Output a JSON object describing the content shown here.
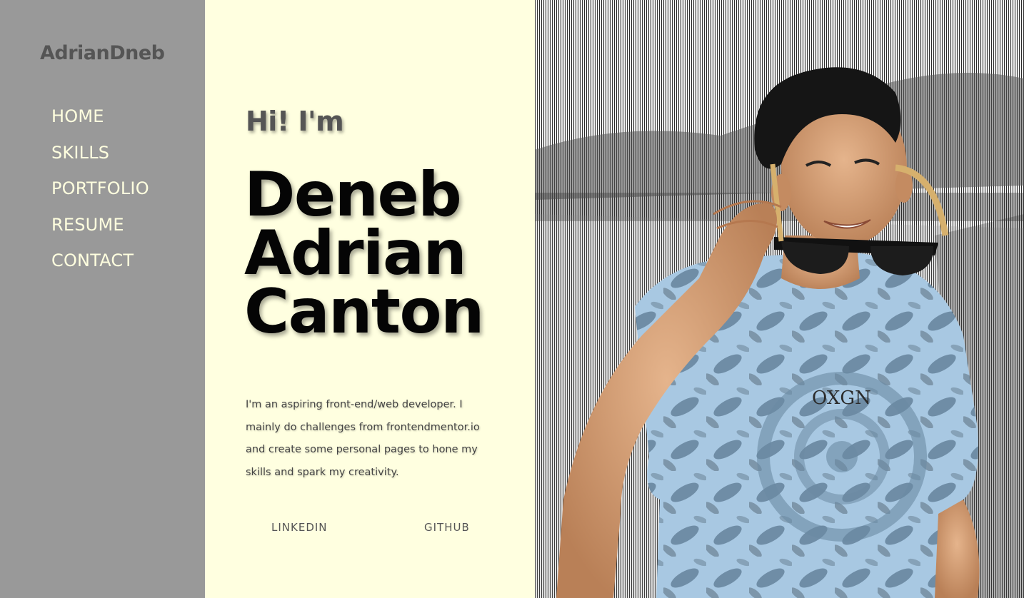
{
  "brand": {
    "logo": "AdrianDneb"
  },
  "nav": {
    "items": [
      {
        "label": "HOME"
      },
      {
        "label": "SKILLS"
      },
      {
        "label": "PORTFOLIO"
      },
      {
        "label": "RESUME"
      },
      {
        "label": "CONTACT"
      }
    ]
  },
  "hero": {
    "greeting": "Hi! I'm",
    "name_lines": [
      "Deneb",
      "Adrian",
      "Canton"
    ],
    "bio": "I'm an aspiring front-end/web developer. I mainly do challenges from frontendmentor.io and create some personal pages to hone my skills and spark my creativity.",
    "links": {
      "linkedin": "LINKEDIN",
      "github": "GITHUB"
    }
  },
  "photo": {
    "shirt_text": "OXGN"
  },
  "colors": {
    "sidebar_bg": "#999999",
    "content_bg": "#ffffe0",
    "nav_text": "#ffffdf",
    "logo_text": "#555555"
  }
}
